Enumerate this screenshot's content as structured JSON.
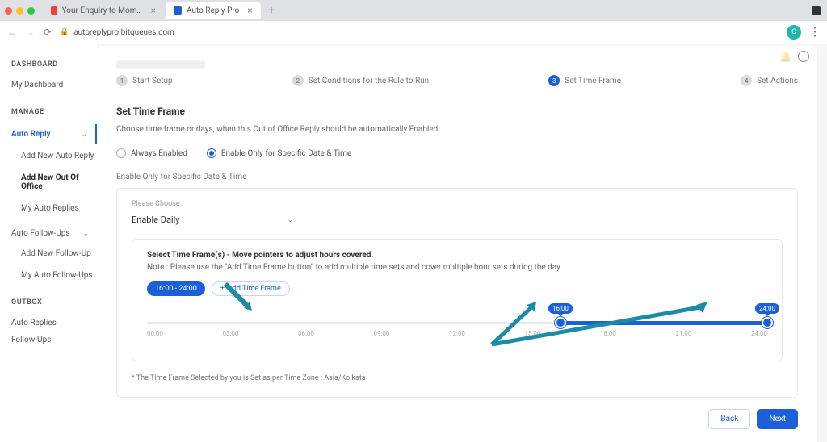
{
  "browser": {
    "tabs": [
      {
        "label": "Your Enquiry to Mom's Bakery",
        "active": false
      },
      {
        "label": "Auto Reply Pro",
        "active": true
      }
    ],
    "url": "autoreplypro.bitqueues.com",
    "avatar_initial": "C"
  },
  "sidebar": {
    "sections": {
      "dashboard": {
        "heading": "DASHBOARD",
        "items": [
          "My Dashboard"
        ]
      },
      "manage": {
        "heading": "MANAGE",
        "auto_reply": {
          "label": "Auto Reply",
          "children": [
            "Add New Auto Reply",
            "Add New Out Of Office",
            "My Auto Replies"
          ]
        },
        "auto_follow": {
          "label": "Auto Follow-Ups",
          "children": [
            "Add New Follow-Up",
            "My Auto Follow-Ups"
          ]
        }
      },
      "outbox": {
        "heading": "OUTBOX",
        "items": [
          "Auto Replies",
          "Follow-Ups"
        ]
      }
    }
  },
  "stepper": [
    {
      "n": "1",
      "label": "Start Setup"
    },
    {
      "n": "2",
      "label": "Set Conditions for the Rule to Run"
    },
    {
      "n": "3",
      "label": "Set Time Frame"
    },
    {
      "n": "4",
      "label": "Set Actions"
    }
  ],
  "page": {
    "title": "Set Time Frame",
    "help": "Choose time frame or days, when this Out of Office Reply should be automatically Enabled.",
    "radio_always": "Always Enabled",
    "radio_specific": "Enable Only for Specific Date & Time",
    "panel_label": "Enable Only for Specific Date & Time",
    "please_choose": "Please Choose",
    "select_value": "Enable Daily",
    "tf_title": "Select Time Frame(s) - Move pointers to adjust hours covered.",
    "tf_note": "Note : Please use the \"Add Time Frame button\" to add multiple time sets and cover multiple hour sets during the day.",
    "chip": "16:00 - 24:00",
    "add_btn": "Add Time Frame",
    "ticks": [
      "00:00",
      "03:00",
      "06:00",
      "09:00",
      "12:00",
      "15:00",
      "18:00",
      "21:00",
      "24:00"
    ],
    "handle_start": "16:00",
    "handle_end": "24:00",
    "tz_note": "* The Time Frame Selected by you is Set as per Time Zone : Asia/Kolkata",
    "back": "Back",
    "next": "Next"
  },
  "chart_data": {
    "type": "range-slider",
    "min": 0,
    "max": 24,
    "unit": "hours",
    "selected_start": 16,
    "selected_end": 24,
    "tick_interval": 3
  }
}
